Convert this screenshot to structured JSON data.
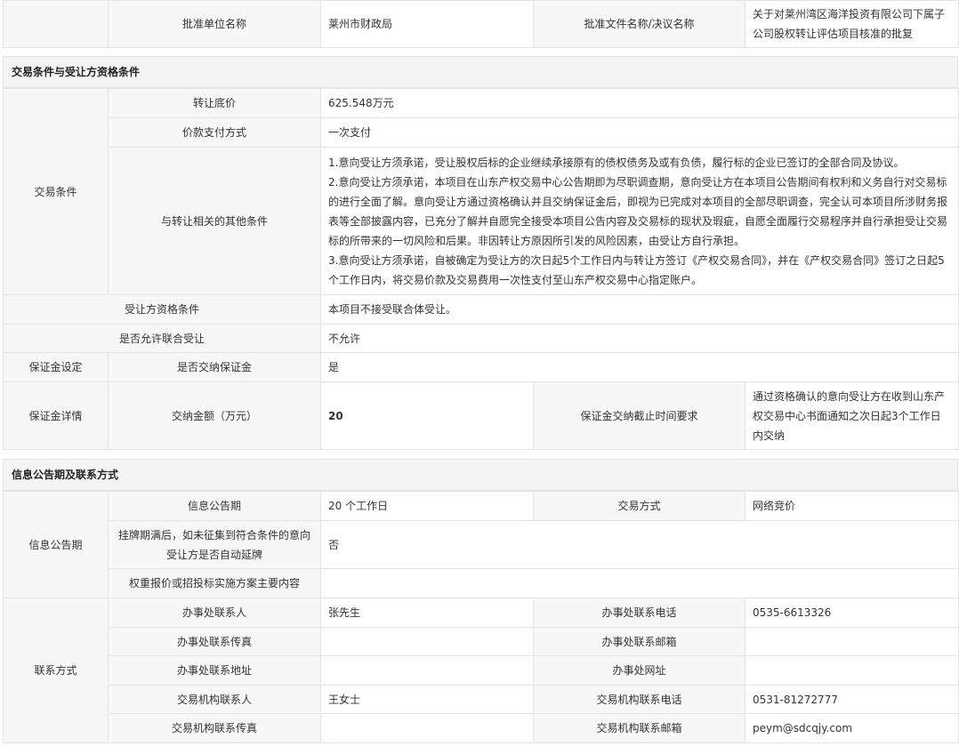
{
  "approval": {
    "unit_label": "批准单位名称",
    "unit_value": "莱州市财政局",
    "doc_label": "批准文件名称/决议名称",
    "doc_value": "关于对莱州湾区海洋投资有限公司下属子公司股权转让评估项目核准的批复"
  },
  "trade_section": {
    "title": "交易条件与受让方资格条件",
    "group_trade": "交易条件",
    "reserve_price_label": "转让底价",
    "reserve_price_value": "625.548万元",
    "payment_label": "价款支付方式",
    "payment_value": "一次支付",
    "other_label": "与转让相关的其他条件",
    "other_items": [
      "1.意向受让方须承诺，受让股权后标的企业继续承接原有的债权债务及或有负债，履行标的企业已签订的全部合同及协议。",
      "2.意向受让方须承诺，本项目在山东产权交易中心公告期即为尽职调查期，意向受让方在本项目公告期间有权利和义务自行对交易标的进行全面了解。意向受让方通过资格确认并且交纳保证金后，即视为已完成对本项目的全部尽职调查，完全认可本项目所涉财务报表等全部披露内容，已充分了解并自愿完全接受本项目公告内容及交易标的现状及瑕疵，自愿全面履行交易程序并自行承担受让交易标的所带来的一切风险和后果。非因转让方原因所引发的风险因素，由受让方自行承担。",
      "3.意向受让方须承诺，自被确定为受让方的次日起5个工作日内与转让方签订《产权交易合同》，并在《产权交易合同》签订之日起5个工作日内，将交易价款及交易费用一次性支付至山东产权交易中心指定账户。"
    ],
    "qualification_label": "受让方资格条件",
    "qualification_value": "本项目不接受联合体受让。",
    "joint_label": "是否允许联合受让",
    "joint_value": "不允许",
    "deposit_group": "保证金设定",
    "deposit_required_label": "是否交纳保证金",
    "deposit_required_value": "是",
    "deposit_detail_group": "保证金详情",
    "deposit_amount_label": "交纳金额（万元）",
    "deposit_amount_value": "20",
    "deposit_deadline_label": "保证金交纳截止时间要求",
    "deposit_deadline_value": "通过资格确认的意向受让方在收到山东产权交易中心书面通知之次日起3个工作日内交纳"
  },
  "info_section": {
    "title": "信息公告期及联系方式",
    "group_period": "信息公告期",
    "period_label": "信息公告期",
    "period_value": "20 个工作日",
    "method_label": "交易方式",
    "method_value": "网络竞价",
    "extend_label": "挂牌期满后，如未征集到符合条件的意向受让方是否自动延牌",
    "extend_value": "否",
    "weight_label": "权重报价或招投标实施方案主要内容",
    "weight_value": "",
    "group_contact": "联系方式",
    "contact_rows": [
      {
        "l1": "办事处联系人",
        "v1": "张先生",
        "l2": "办事处联系电话",
        "v2": "0535-6613326"
      },
      {
        "l1": "办事处联系传真",
        "v1": "",
        "l2": "办事处联系邮箱",
        "v2": ""
      },
      {
        "l1": "办事处联系地址",
        "v1": "",
        "l2": "办事处网址",
        "v2": ""
      },
      {
        "l1": "交易机构联系人",
        "v1": "王女士",
        "l2": "交易机构联系电话",
        "v2": "0531-81272777"
      },
      {
        "l1": "交易机构联系传真",
        "v1": "",
        "l2": "交易机构联系邮箱",
        "v2": "peym@sdcqjy.com"
      }
    ]
  }
}
